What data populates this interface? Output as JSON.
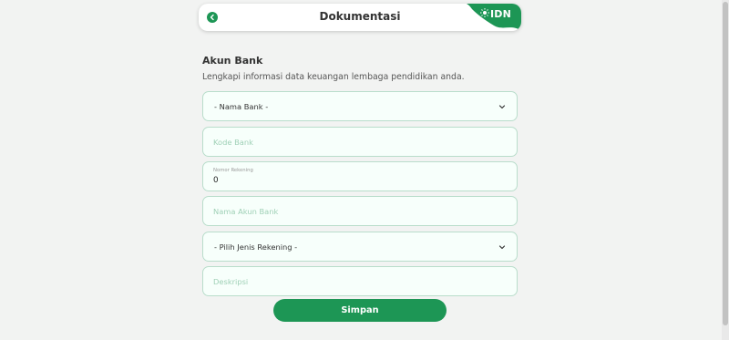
{
  "header": {
    "title": "Dokumentasi",
    "brand": "IDN",
    "brand_color": "#1d9655",
    "back_icon": "chevron-left-icon"
  },
  "section": {
    "title": "Akun Bank",
    "description": "Lengkapi informasi data keuangan lembaga pendidikan anda."
  },
  "form": {
    "bank_name_selected": "- Nama Bank -",
    "bank_code_placeholder": "Kode Bank",
    "account_number_label": "Nomor Rekening",
    "account_number_value": "0",
    "account_name_placeholder": "Nama Akun Bank",
    "account_type_selected": "- Pilih Jenis Rekening -",
    "description_placeholder": "Deskripsi",
    "submit_label": "Simpan"
  },
  "colors": {
    "accent": "#1d9655",
    "field_bg": "#f7fffb",
    "field_border": "#b9ddcb",
    "placeholder": "#9fd0b6"
  }
}
